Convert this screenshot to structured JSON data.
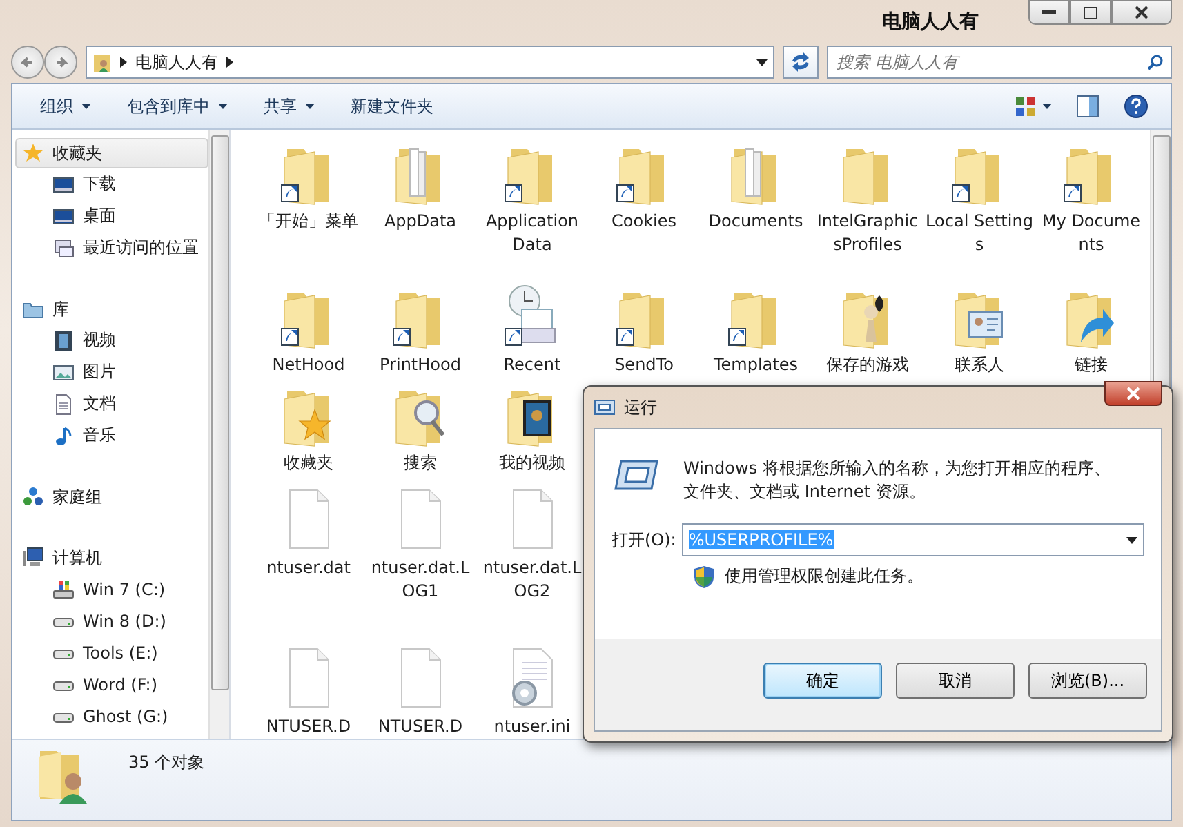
{
  "window": {
    "title": "电脑人人有"
  },
  "address": {
    "crumbs": [
      "电脑人人有"
    ],
    "search_placeholder": "搜索 电脑人人有"
  },
  "toolbar": {
    "items": [
      {
        "label": "组织",
        "dropdown": true
      },
      {
        "label": "包含到库中",
        "dropdown": true
      },
      {
        "label": "共享",
        "dropdown": true
      },
      {
        "label": "新建文件夹",
        "dropdown": false
      }
    ]
  },
  "sidebar": {
    "groups": [
      {
        "label": "收藏夹",
        "kind": "star",
        "selected": true,
        "children": [
          {
            "label": "下载",
            "kind": "desktop",
            "selected": false
          },
          {
            "label": "桌面",
            "kind": "desktop",
            "selected": false
          },
          {
            "label": "最近访问的位置",
            "kind": "recent",
            "selected": false
          }
        ]
      },
      {
        "label": "库",
        "kind": "library",
        "selected": false,
        "children": [
          {
            "label": "视频",
            "kind": "film",
            "selected": false
          },
          {
            "label": "图片",
            "kind": "picture",
            "selected": false
          },
          {
            "label": "文档",
            "kind": "document",
            "selected": false
          },
          {
            "label": "音乐",
            "kind": "music",
            "selected": false
          }
        ]
      },
      {
        "label": "家庭组",
        "kind": "homegroup",
        "selected": false
      },
      {
        "label": "计算机",
        "kind": "computer",
        "selected": false,
        "children": [
          {
            "label": "Win 7 (C:)",
            "kind": "system-drive",
            "selected": false
          },
          {
            "label": "Win 8 (D:)",
            "kind": "drive",
            "selected": false
          },
          {
            "label": "Tools (E:)",
            "kind": "drive",
            "selected": false
          },
          {
            "label": "Word (F:)",
            "kind": "drive",
            "selected": false
          },
          {
            "label": "Ghost (G:)",
            "kind": "drive",
            "selected": false
          }
        ]
      }
    ]
  },
  "files": {
    "rows": [
      [
        {
          "name": "「开始」菜单",
          "kind": "shortcut"
        },
        {
          "name": "AppData",
          "kind": "papers"
        },
        {
          "name": "Application Data",
          "kind": "shortcut"
        },
        {
          "name": "Cookies",
          "kind": "shortcut"
        },
        {
          "name": "Documents",
          "kind": "papers"
        },
        {
          "name": "IntelGraphicsProfiles",
          "kind": "folder"
        },
        {
          "name": "Local Settings",
          "kind": "shortcut"
        },
        {
          "name": "My Documents",
          "kind": "shortcut"
        }
      ],
      [
        {
          "name": "NetHood",
          "kind": "shortcut"
        },
        {
          "name": "PrintHood",
          "kind": "shortcut"
        },
        {
          "name": "Recent",
          "kind": "recent"
        },
        {
          "name": "SendTo",
          "kind": "shortcut"
        },
        {
          "name": "Templates",
          "kind": "shortcut"
        },
        {
          "name": "保存的游戏",
          "kind": "games"
        },
        {
          "name": "联系人",
          "kind": "contacts"
        },
        {
          "name": "链接",
          "kind": "links"
        }
      ],
      [
        {
          "name": "收藏夹",
          "kind": "favorites"
        },
        {
          "name": "搜索",
          "kind": "search"
        },
        {
          "name": "我的视频",
          "kind": "video"
        }
      ],
      [
        {
          "name": "ntuser.dat",
          "kind": "file"
        },
        {
          "name": "ntuser.dat.LOG1",
          "kind": "file"
        },
        {
          "name": "ntuser.dat.LOG2",
          "kind": "file"
        }
      ],
      [
        {
          "name": "NTUSER.D",
          "kind": "file"
        },
        {
          "name": "NTUSER.D",
          "kind": "file"
        },
        {
          "name": "ntuser.ini",
          "kind": "ini"
        }
      ]
    ]
  },
  "status_bar": {
    "text": "35 个对象"
  },
  "run_dialog": {
    "title": "运行",
    "message": "Windows 将根据您所输入的名称，为您打开相应的程序、文件夹、文档或 Internet 资源。",
    "open_label": "打开(O):",
    "open_value": "%USERPROFILE%",
    "admin_note": "使用管理权限创建此任务。",
    "buttons": [
      {
        "label": "确定",
        "selected": true
      },
      {
        "label": "取消",
        "selected": false
      },
      {
        "label": "浏览(B)...",
        "selected": false
      }
    ]
  }
}
